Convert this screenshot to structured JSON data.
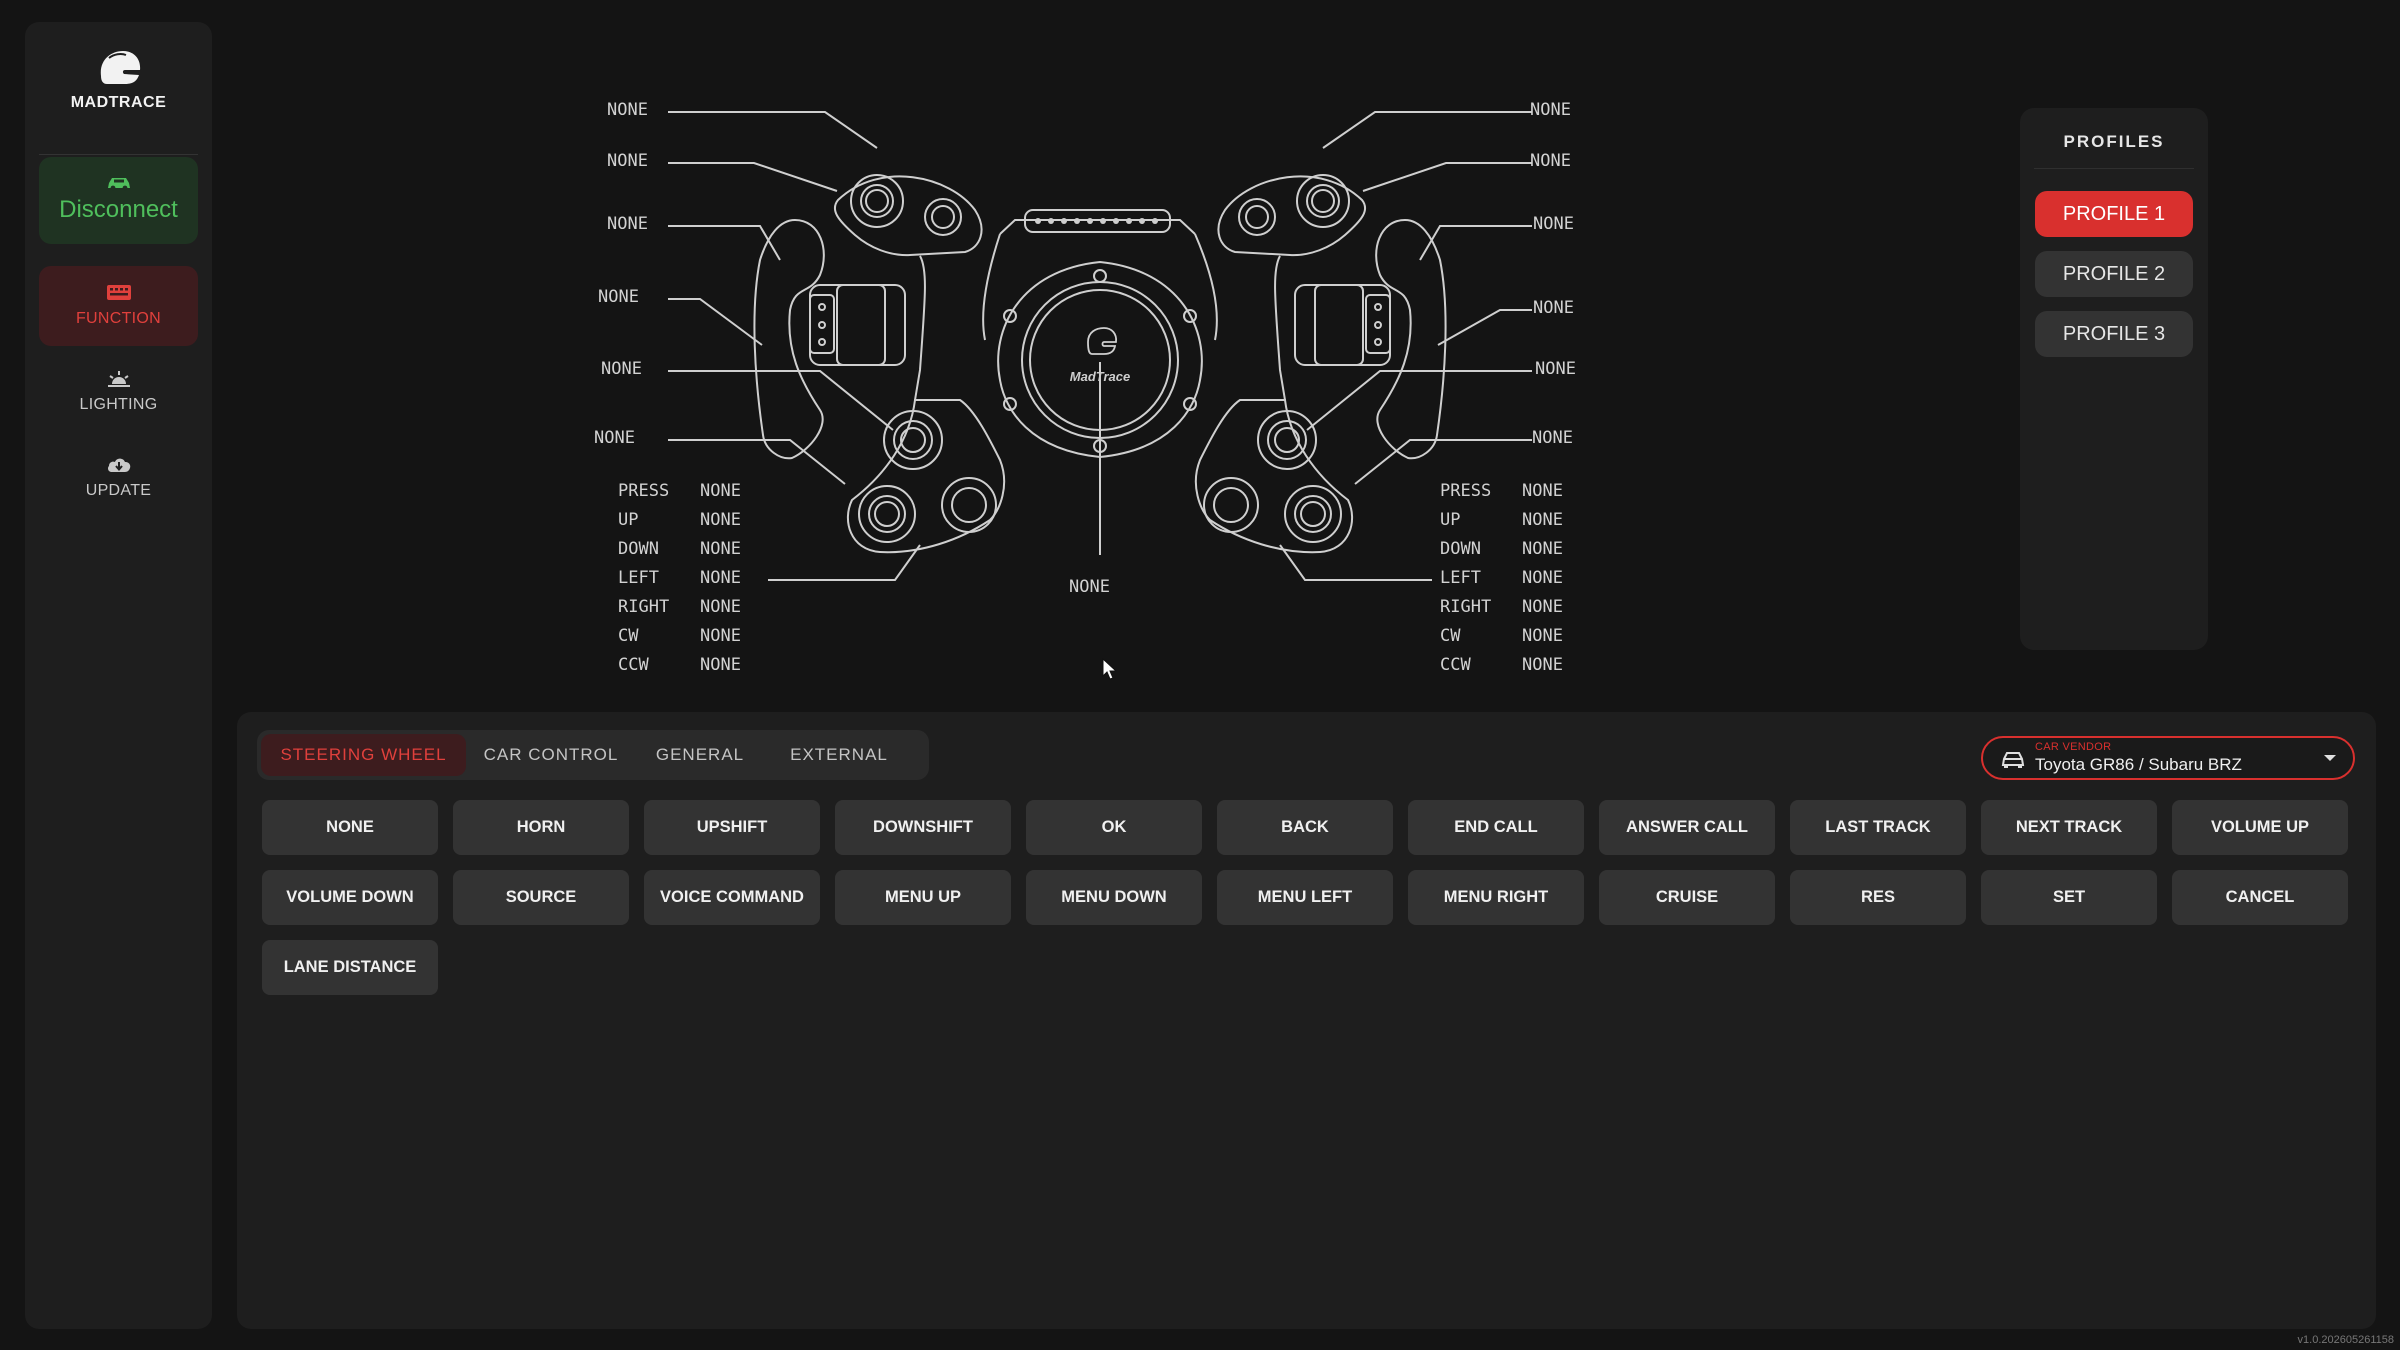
{
  "app": {
    "brand": "MADTRACE",
    "version": "v1.0.202605261158"
  },
  "sidebar": {
    "connection_label": "Disconnect",
    "items": [
      {
        "label": "FUNCTION",
        "icon": "keyboard-icon",
        "active": true
      },
      {
        "label": "LIGHTING",
        "icon": "sunrise-icon",
        "active": false
      },
      {
        "label": "UPDATE",
        "icon": "cloud-download-icon",
        "active": false
      }
    ]
  },
  "diagram": {
    "left_labels": [
      "NONE",
      "NONE",
      "NONE",
      "NONE",
      "NONE",
      "NONE"
    ],
    "right_labels": [
      "NONE",
      "NONE",
      "NONE",
      "NONE",
      "NONE",
      "NONE"
    ],
    "center_label": "NONE",
    "left_encoder": [
      {
        "key": "PRESS",
        "value": "NONE"
      },
      {
        "key": "UP",
        "value": "NONE"
      },
      {
        "key": "DOWN",
        "value": "NONE"
      },
      {
        "key": "LEFT",
        "value": "NONE"
      },
      {
        "key": "RIGHT",
        "value": "NONE"
      },
      {
        "key": "CW",
        "value": "NONE"
      },
      {
        "key": "CCW",
        "value": "NONE"
      }
    ],
    "right_encoder": [
      {
        "key": "PRESS",
        "value": "NONE"
      },
      {
        "key": "UP",
        "value": "NONE"
      },
      {
        "key": "DOWN",
        "value": "NONE"
      },
      {
        "key": "LEFT",
        "value": "NONE"
      },
      {
        "key": "RIGHT",
        "value": "NONE"
      },
      {
        "key": "CW",
        "value": "NONE"
      },
      {
        "key": "CCW",
        "value": "NONE"
      }
    ]
  },
  "profiles": {
    "title": "PROFILES",
    "items": [
      {
        "label": "PROFILE 1",
        "active": true
      },
      {
        "label": "PROFILE 2",
        "active": false
      },
      {
        "label": "PROFILE 3",
        "active": false
      }
    ]
  },
  "tabs": [
    {
      "label": "STEERING WHEEL",
      "active": true
    },
    {
      "label": "CAR CONTROL",
      "active": false
    },
    {
      "label": "GENERAL",
      "active": false
    },
    {
      "label": "EXTERNAL",
      "active": false
    }
  ],
  "vendor": {
    "caption": "CAR VENDOR",
    "value": "Toyota GR86 / Subaru BRZ"
  },
  "functions": [
    "NONE",
    "HORN",
    "UPSHIFT",
    "DOWNSHIFT",
    "OK",
    "BACK",
    "END CALL",
    "ANSWER CALL",
    "LAST TRACK",
    "NEXT TRACK",
    "VOLUME UP",
    "VOLUME DOWN",
    "SOURCE",
    "VOICE COMMAND",
    "MENU UP",
    "MENU DOWN",
    "MENU LEFT",
    "MENU RIGHT",
    "CRUISE",
    "RES",
    "SET",
    "CANCEL",
    "LANE DISTANCE"
  ],
  "colors": {
    "accent": "#d9302e",
    "connected": "#4fbf5c",
    "panel": "#1e1e1e",
    "background": "#141414"
  }
}
